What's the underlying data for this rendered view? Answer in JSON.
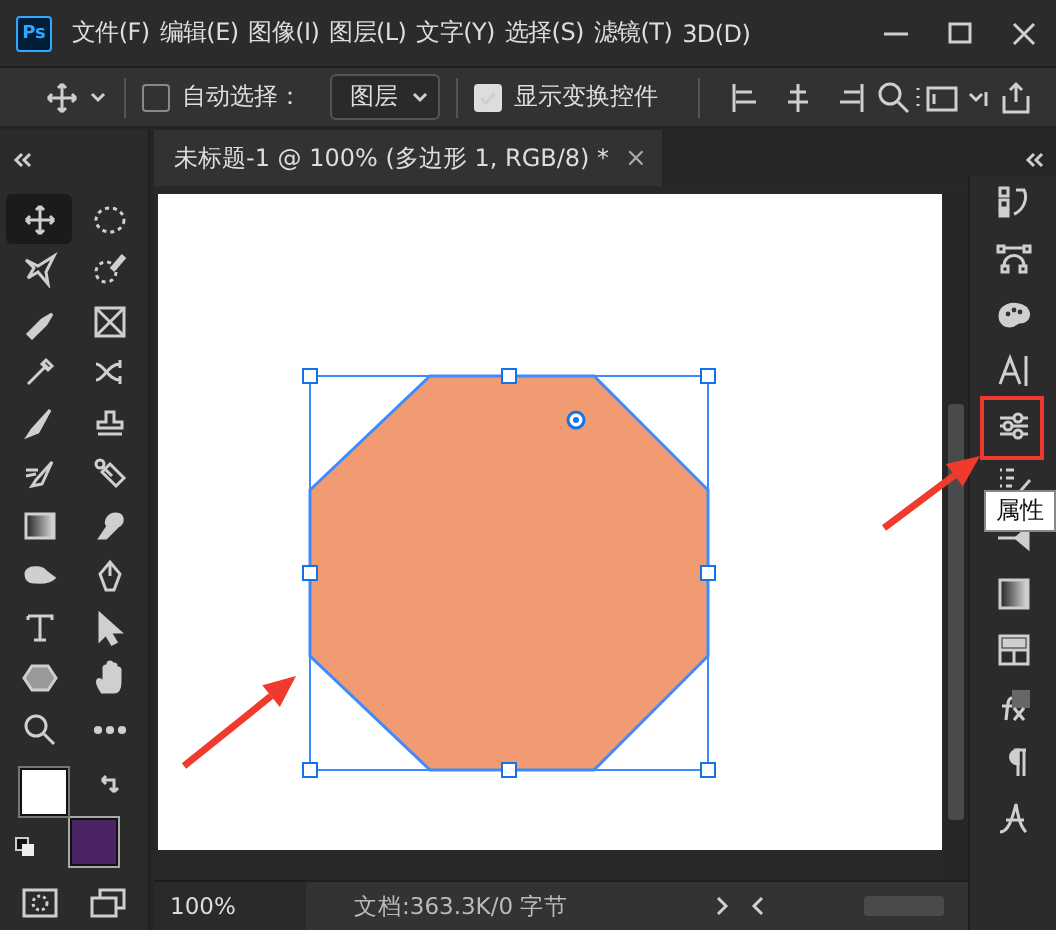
{
  "app": {
    "logo": "Ps"
  },
  "menu": [
    "文件(F)",
    "编辑(E)",
    "图像(I)",
    "图层(L)",
    "文字(Y)",
    "选择(S)",
    "滤镜(T)",
    "3D(D)"
  ],
  "options_bar": {
    "auto_select": {
      "label": "自动选择：",
      "checked": false
    },
    "target_dropdown": {
      "value": "图层"
    },
    "show_transform": {
      "label": "显示变换控件",
      "checked": true
    }
  },
  "document_tab": {
    "title": "未标题-1 @ 100% (多边形 1, RGB/8) *",
    "close": "×"
  },
  "tools": [
    {
      "selected": true
    },
    {
      "selected": false
    },
    {
      "selected": false
    },
    {
      "selected": false
    },
    {
      "selected": false
    },
    {
      "selected": false
    },
    {
      "selected": false
    },
    {
      "selected": false
    },
    {
      "selected": false
    },
    {
      "selected": false
    },
    {
      "selected": false
    },
    {
      "selected": false
    },
    {
      "selected": false
    },
    {
      "selected": false
    },
    {
      "selected": false
    },
    {
      "selected": false
    },
    {
      "selected": false
    },
    {
      "selected": false
    },
    {
      "selected": false
    },
    {
      "selected": false
    },
    {
      "selected": false
    },
    {
      "selected": false
    }
  ],
  "swatches": [
    {
      "kind": "foreground",
      "color": "#ffffff"
    },
    {
      "kind": "background",
      "color": "#4a2463"
    }
  ],
  "tooltip": "属性",
  "status_bar": {
    "zoom": "100%",
    "doc_info": "文档:363.3K/0 字节"
  }
}
